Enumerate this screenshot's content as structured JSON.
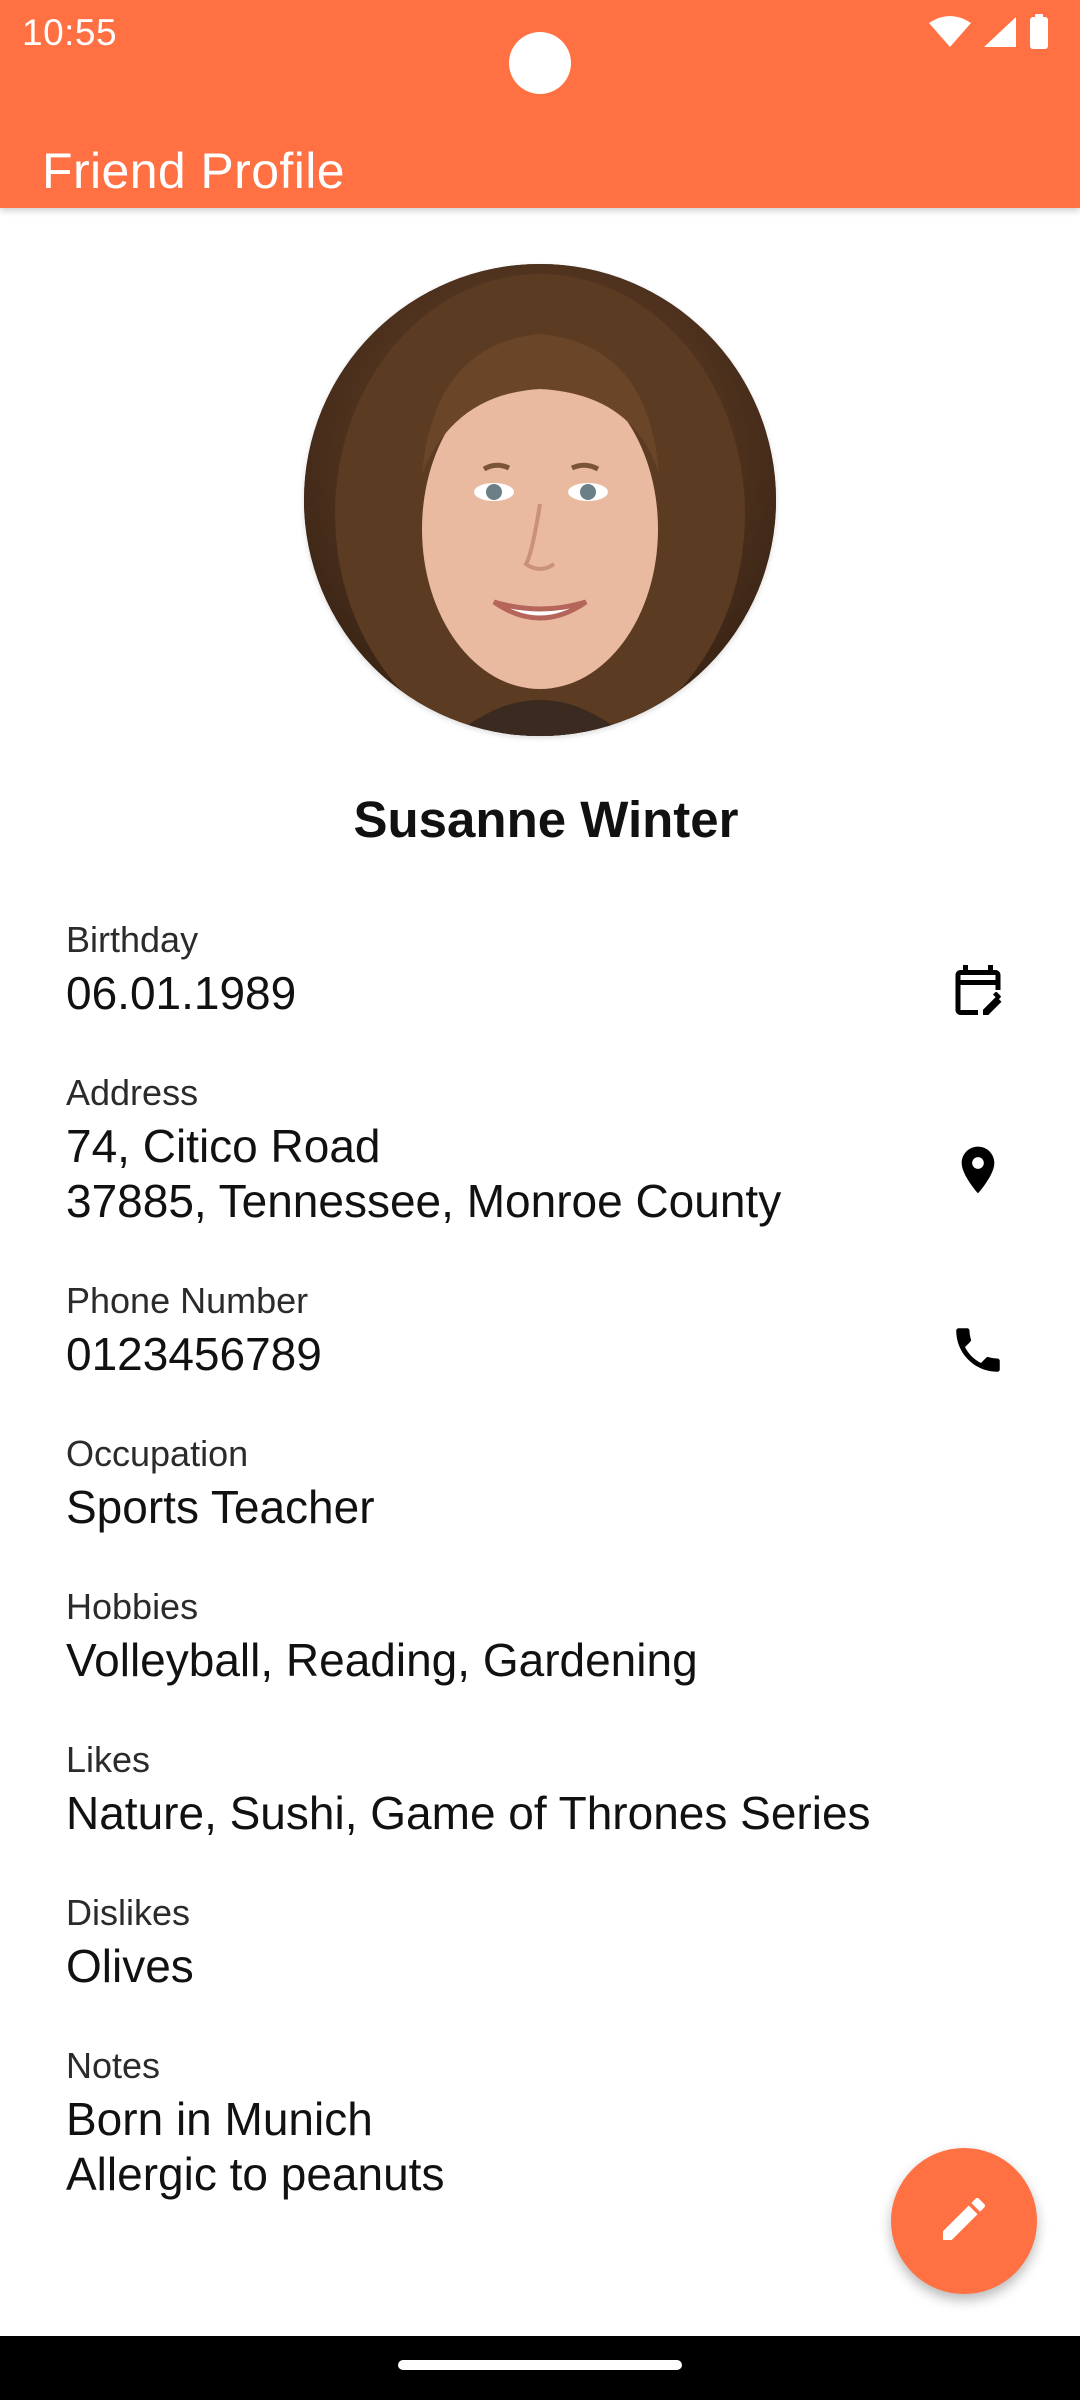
{
  "status_bar": {
    "time": "10:55",
    "icons": [
      "wifi-icon",
      "cellular-signal-icon",
      "battery-icon"
    ]
  },
  "app_bar": {
    "title": "Friend Profile"
  },
  "theme": {
    "accent": "#FF7043",
    "on_accent": "#FFFFFF"
  },
  "profile": {
    "name": "Susanne Winter",
    "avatar_icon": "profile-photo"
  },
  "fields": [
    {
      "label": "Birthday",
      "value": "06.01.1989",
      "action_icon": "calendar-edit-icon"
    },
    {
      "label": "Address",
      "value": "74, Citico Road\n37885, Tennessee, Monroe County",
      "action_icon": "location-pin-icon"
    },
    {
      "label": "Phone Number",
      "value": "0123456789",
      "action_icon": "phone-icon"
    },
    {
      "label": "Occupation",
      "value": "Sports Teacher"
    },
    {
      "label": "Hobbies",
      "value": "Volleyball, Reading, Gardening"
    },
    {
      "label": "Likes",
      "value": "Nature, Sushi, Game of Thrones Series"
    },
    {
      "label": "Dislikes",
      "value": "Olives"
    },
    {
      "label": "Notes",
      "value": "Born in Munich\nAllergic to peanuts"
    }
  ],
  "fab": {
    "icon": "edit-pencil-icon"
  }
}
